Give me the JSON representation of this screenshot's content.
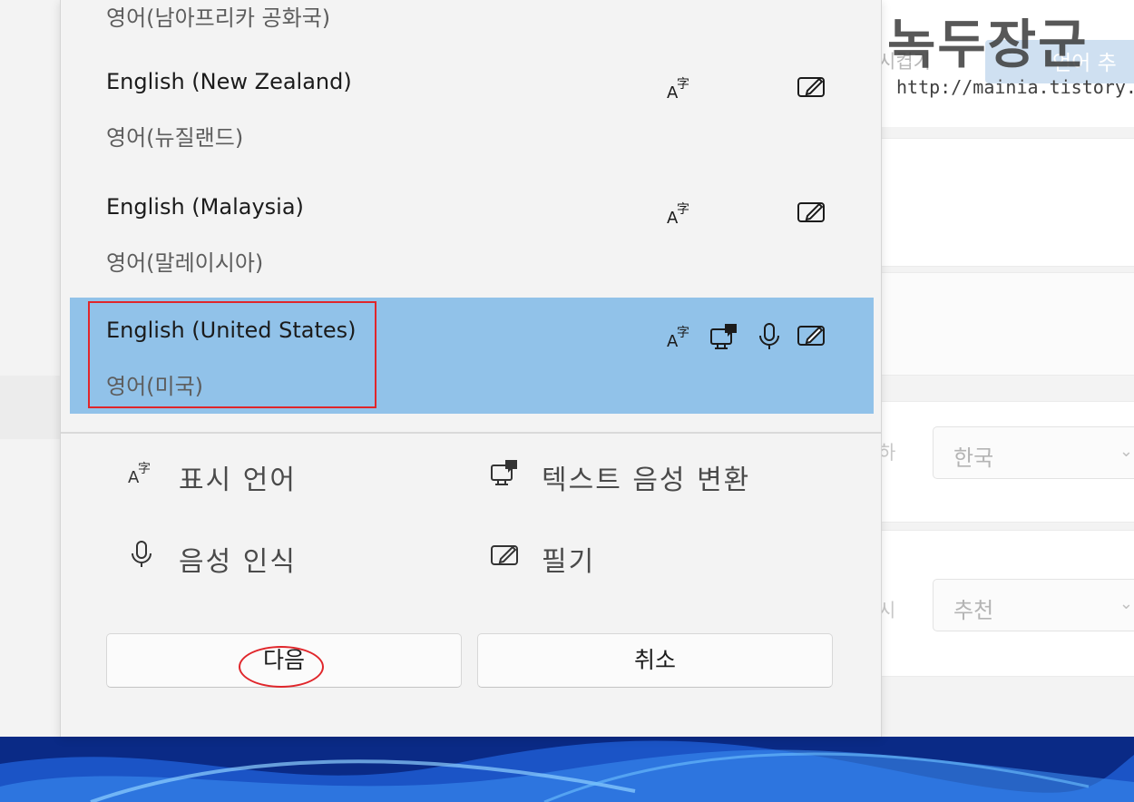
{
  "background": {
    "tab_fragment": "시켭기",
    "add_button_fragment": "언어 추",
    "region_label_fragment": "하",
    "region_value": "한국",
    "format_label_fragment": "시",
    "format_value": "추천"
  },
  "watermark": {
    "title": "녹두장군",
    "url": "http://mainia.tistory.com"
  },
  "language_list": [
    {
      "english": "",
      "korean": "영어(남아프리카 공화국)"
    },
    {
      "english": "English (New Zealand)",
      "korean": "영어(뉴질랜드)",
      "icons": [
        "display-language-icon",
        "handwriting-icon"
      ]
    },
    {
      "english": "English (Malaysia)",
      "korean": "영어(말레이시아)",
      "icons": [
        "display-language-icon",
        "handwriting-icon"
      ]
    },
    {
      "english": "English (United States)",
      "korean": "영어(미국)",
      "selected": true,
      "icons": [
        "display-language-icon",
        "text-to-speech-icon",
        "speech-recognition-icon",
        "handwriting-icon"
      ]
    }
  ],
  "features": {
    "display_language": "표시 언어",
    "text_to_speech": "텍스트 음성 변환",
    "speech_recognition": "음성 인식",
    "handwriting": "필기"
  },
  "buttons": {
    "next": "다음",
    "cancel": "취소"
  },
  "colors": {
    "selected_row": "#91c2e9",
    "annotation": "#e0262b"
  }
}
